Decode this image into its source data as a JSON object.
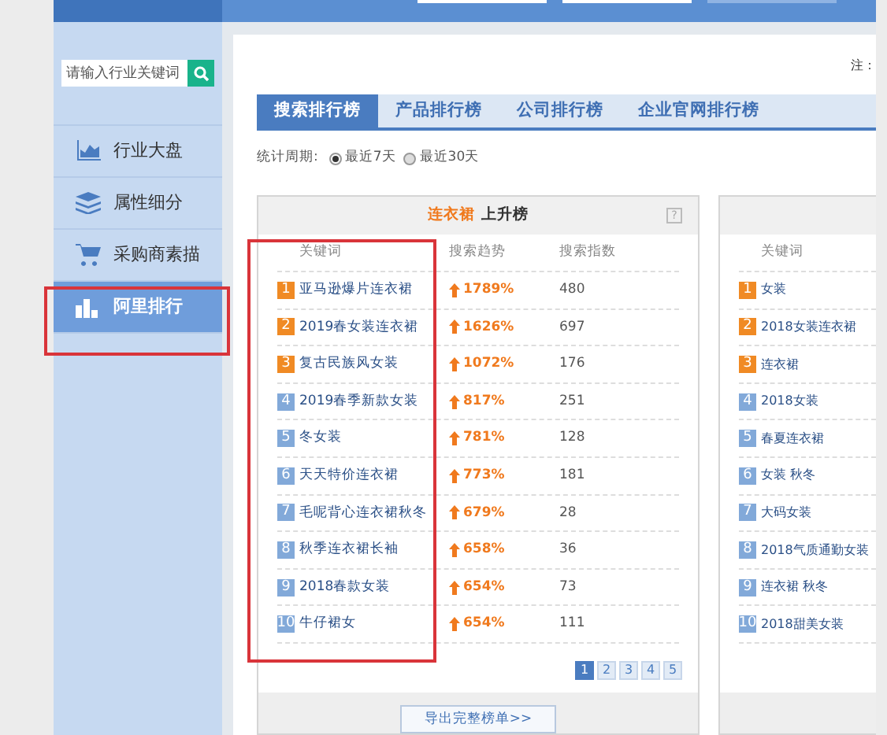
{
  "sidebar": {
    "search": {
      "placeholder": "请输入行业关键词"
    },
    "items": [
      {
        "label": "行业大盘",
        "kind": "chart",
        "selected": false
      },
      {
        "label": "属性细分",
        "kind": "layers",
        "selected": false
      },
      {
        "label": "采购商素描",
        "kind": "cart",
        "selected": false
      },
      {
        "label": "阿里排行",
        "kind": "bars",
        "selected": true
      }
    ]
  },
  "note": "注：",
  "tabs": [
    {
      "label": "搜索排行榜",
      "selected": true
    },
    {
      "label": "产品排行榜",
      "selected": false
    },
    {
      "label": "公司排行榜",
      "selected": false
    },
    {
      "label": "企业官网排行榜",
      "selected": false
    }
  ],
  "period": {
    "label": "统计周期:",
    "options": [
      {
        "label": "最近7天",
        "selected": true
      },
      {
        "label": "最近30天",
        "selected": false
      }
    ]
  },
  "ranking_card": {
    "category": "连衣裙",
    "title": "上升榜",
    "help": "?",
    "columns": [
      "关键词",
      "搜索趋势",
      "搜索指数"
    ],
    "rows": [
      {
        "rank": "1",
        "top": true,
        "keyword": "亚马逊爆片连衣裙",
        "trend": "1789%",
        "index": "480"
      },
      {
        "rank": "2",
        "top": true,
        "keyword": "2019春女装连衣裙",
        "trend": "1626%",
        "index": "697"
      },
      {
        "rank": "3",
        "top": true,
        "keyword": "复古民族风女装",
        "trend": "1072%",
        "index": "176"
      },
      {
        "rank": "4",
        "top": false,
        "keyword": "2019春季新款女装",
        "trend": "817%",
        "index": "251"
      },
      {
        "rank": "5",
        "top": false,
        "keyword": "冬女装",
        "trend": "781%",
        "index": "128"
      },
      {
        "rank": "6",
        "top": false,
        "keyword": "天天特价连衣裙",
        "trend": "773%",
        "index": "181"
      },
      {
        "rank": "7",
        "top": false,
        "keyword": "毛呢背心连衣裙秋冬",
        "trend": "679%",
        "index": "28"
      },
      {
        "rank": "8",
        "top": false,
        "keyword": "秋季连衣裙长袖",
        "trend": "658%",
        "index": "36"
      },
      {
        "rank": "9",
        "top": false,
        "keyword": "2018春款女装",
        "trend": "654%",
        "index": "73"
      },
      {
        "rank": "10",
        "top": false,
        "keyword": "牛仔裙女",
        "trend": "654%",
        "index": "111"
      }
    ],
    "pages": [
      {
        "label": "1",
        "selected": true
      },
      {
        "label": "2",
        "selected": false
      },
      {
        "label": "3",
        "selected": false
      },
      {
        "label": "4",
        "selected": false
      },
      {
        "label": "5",
        "selected": false
      }
    ],
    "export_button": "导出完整榜单>>"
  },
  "second_card": {
    "columns": [
      "关键词"
    ],
    "rows": [
      {
        "rank": "1",
        "top": true,
        "keyword": "女装"
      },
      {
        "rank": "2",
        "top": true,
        "keyword": "2018女装连衣裙"
      },
      {
        "rank": "3",
        "top": true,
        "keyword": "连衣裙"
      },
      {
        "rank": "4",
        "top": false,
        "keyword": "2018女装"
      },
      {
        "rank": "5",
        "top": false,
        "keyword": "春夏连衣裙"
      },
      {
        "rank": "6",
        "top": false,
        "keyword": "女装 秋冬"
      },
      {
        "rank": "7",
        "top": false,
        "keyword": "大码女装"
      },
      {
        "rank": "8",
        "top": false,
        "keyword": "2018气质通勤女装"
      },
      {
        "rank": "9",
        "top": false,
        "keyword": "连衣裙 秋冬"
      },
      {
        "rank": "10",
        "top": false,
        "keyword": "2018甜美女装"
      }
    ]
  }
}
